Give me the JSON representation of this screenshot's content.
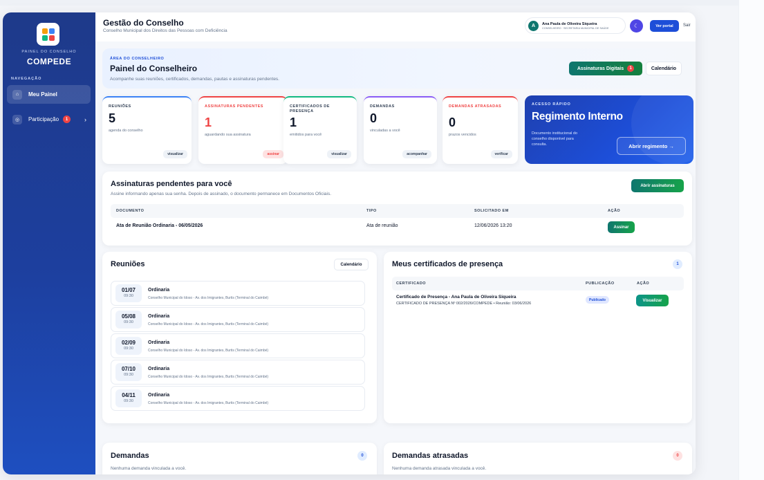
{
  "sidebar": {
    "kicker": "PAINEL DO CONSELHO",
    "title": "COMPEDE",
    "nav_label": "NAVEGAÇÃO",
    "items": [
      {
        "label": "Meu Painel",
        "icon": "home-icon"
      },
      {
        "label": "Participação",
        "icon": "circle-icon",
        "badge": "1"
      }
    ]
  },
  "header": {
    "title": "Gestão do Conselho",
    "subtitle": "Conselho Municipal dos Direitos das Pessoas com Deficiência",
    "user": {
      "initial": "A",
      "name": "Ana Paula de Oliveira Siqueira",
      "role": "CONSELHEIRO · SECRETARIA MUNICIPAL DE SAÚDE"
    },
    "portal_label": "Ver portal",
    "logout_label": "Sair"
  },
  "hero": {
    "kicker": "ÁREA DO CONSELHEIRO",
    "title": "Painel do Conselheiro",
    "subtitle": "Acompanhe suas reuniões, certificados, demandas, pautas e assinaturas pendentes.",
    "signatures_label": "Assinaturas Digitais",
    "signatures_badge": "1",
    "calendar_label": "Calendário"
  },
  "stats": [
    {
      "label": "REUNIÕES",
      "value": "5",
      "desc": "agenda do conselho",
      "action": "visualizar",
      "color": "#3b82f6"
    },
    {
      "label": "ASSINATURAS PENDENTES",
      "value": "1",
      "desc": "aguardando sua assinatura",
      "action": "assinar",
      "color": "#ef4444"
    },
    {
      "label": "CERTIFICADOS DE PRESENÇA",
      "value": "1",
      "desc": "emitidos para você",
      "action": "visualizar",
      "color": "#10b981"
    },
    {
      "label": "DEMANDAS",
      "value": "0",
      "desc": "vinculadas a você",
      "action": "acompanhar",
      "color": "#8b5cf6"
    },
    {
      "label": "DEMANDAS ATRASADAS",
      "value": "0",
      "desc": "prazos vencidos",
      "action": "verificar",
      "color": "#ef4444"
    }
  ],
  "quick": {
    "kicker": "ACESSO RÁPIDO",
    "title": "Regimento Interno",
    "desc": "Documento institucional do conselho disponível para consulta.",
    "button": "Abrir regimento →"
  },
  "pending": {
    "title": "Assinaturas pendentes para você",
    "subtitle": "Assine informando apenas sua senha. Depois de assinado, o documento permanece em Documentos Oficiais.",
    "open_label": "Abrir assinaturas",
    "columns": [
      "DOCUMENTO",
      "TIPO",
      "SOLICITADO EM",
      "AÇÃO"
    ],
    "rows": [
      {
        "doc": "Ata de Reunião Ordinaria - 06/05/2026",
        "type": "Ata de reunião",
        "date": "12/06/2026 13:20",
        "action": "Assinar"
      }
    ]
  },
  "meetings": {
    "title": "Reuniões",
    "calendar_label": "Calendário",
    "items": [
      {
        "date": "01/07",
        "time": "09:30",
        "type": "Ordinaria",
        "loc": "Conselho Municipal do Idoso - Av. dos Imigrantes, Burtis (Terminal do Caimbé)"
      },
      {
        "date": "05/08",
        "time": "09:30",
        "type": "Ordinaria",
        "loc": "Conselho Municipal do Idoso - Av. dos Imigrantes, Burtis (Terminal do Caimbé)"
      },
      {
        "date": "02/09",
        "time": "09:30",
        "type": "Ordinaria",
        "loc": "Conselho Municipal do Idoso - Av. dos Imigrantes, Burtis (Terminal do Caimbé)"
      },
      {
        "date": "07/10",
        "time": "09:30",
        "type": "Ordinaria",
        "loc": "Conselho Municipal do Idoso - Av. dos Imigrantes, Burtis (Terminal do Caimbé)"
      },
      {
        "date": "04/11",
        "time": "09:30",
        "type": "Ordinaria",
        "loc": "Conselho Municipal do Idoso - Av. dos Imigrantes, Burtis (Terminal do Caimbé)"
      }
    ]
  },
  "certificates": {
    "title": "Meus certificados de presença",
    "count": "1",
    "columns": [
      "CERTIFICADO",
      "PUBLICAÇÃO",
      "AÇÃO"
    ],
    "rows": [
      {
        "name": "Certificado de Presença - Ana Paula de Oliveira Siqueira",
        "meta": "CERTIFICADO DE PRESENÇA Nº 002/2026/COMPEDE • Reunião: 03/06/2026",
        "status": "Publicado",
        "action": "Visualizar"
      }
    ]
  },
  "demands": {
    "title": "Demandas",
    "count": "0",
    "empty": "Nenhuma demanda vinculada a você."
  },
  "late_demands": {
    "title": "Demandas atrasadas",
    "count": "0",
    "empty": "Nenhuma demanda atrasada vinculada a você."
  }
}
